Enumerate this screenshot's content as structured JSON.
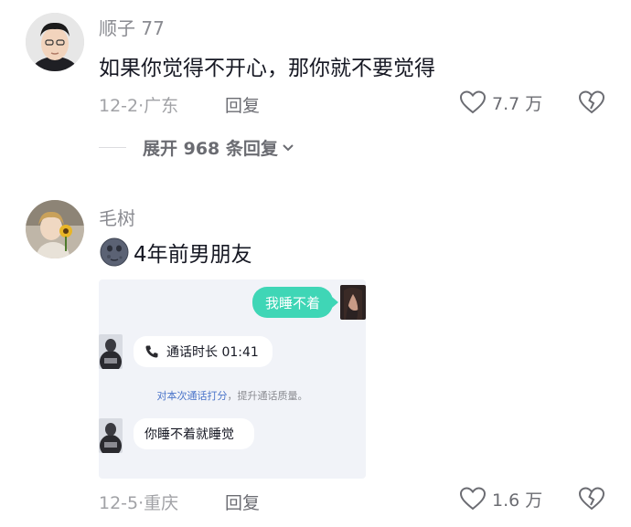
{
  "comment1": {
    "username": "顺子 77",
    "text": "如果你觉得不开心，那你就不要觉得",
    "date": "12-2",
    "location": "广东",
    "reply_label": "回复",
    "likes": "7.7 万",
    "expand_label": "展开 968 条回复"
  },
  "comment2": {
    "username": "毛树",
    "text": "4年前男朋友",
    "date": "12-5",
    "location": "重庆",
    "reply_label": "回复",
    "likes": "1.6 万",
    "chat": {
      "msg_sent": "我睡不着",
      "call_text": "通话时长 01:41",
      "system_link": "对本次通话打分",
      "system_rest": "，提升通话质量。",
      "msg_received": "你睡不着就睡觉"
    }
  },
  "colors": {
    "accent_green": "#3fd6b6",
    "text_gray": "#a1a2a6"
  },
  "icons": [
    "heart-icon",
    "broken-heart-icon",
    "chevron-down-icon",
    "phone-icon",
    "emoji-icon"
  ]
}
